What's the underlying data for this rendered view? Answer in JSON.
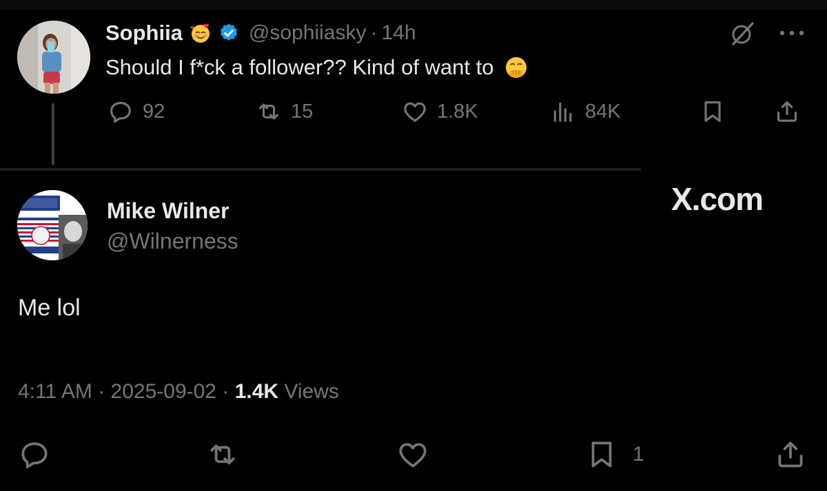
{
  "colors": {
    "background": "#000000",
    "text": "#e7e9ea",
    "muted": "#71767b",
    "verified": "#1d9bf0"
  },
  "original_tweet": {
    "name": "Sophiia",
    "name_emoji": "smiling-face-with-hearts-icon",
    "verified": true,
    "handle": "@sophiiasky",
    "separator": "·",
    "time": "14h",
    "text": "Should I f*ck a follower?? Kind of want to",
    "text_emoji": "face-with-hand-over-mouth-icon",
    "actions": {
      "replies": "92",
      "reposts": "15",
      "likes": "1.8K",
      "views": "84K"
    }
  },
  "watermark": "X.com",
  "reply_tweet": {
    "name": "Mike Wilner",
    "handle": "@Wilnerness",
    "text": "Me lol",
    "timestamp": "4:11 AM",
    "separator": "·",
    "date": "2025-09-02",
    "views_count": "1.4K",
    "views_label": "Views",
    "bookmark_count": "1"
  }
}
